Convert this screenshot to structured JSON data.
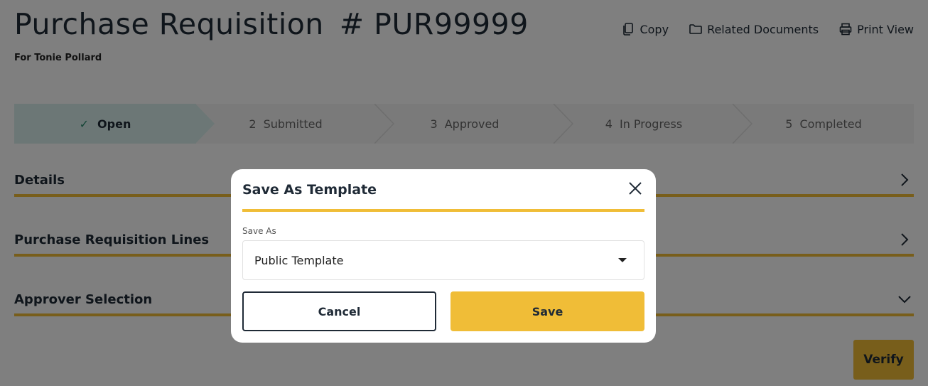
{
  "header": {
    "title": "Purchase Requisition",
    "number": "# PUR99999",
    "subtitle": "For Tonie Pollard"
  },
  "actions": [
    {
      "label": "Copy",
      "icon": "copy-icon"
    },
    {
      "label": "Related Documents",
      "icon": "folder-icon"
    },
    {
      "label": "Print View",
      "icon": "printer-icon"
    }
  ],
  "stepper": {
    "steps": [
      {
        "num": "",
        "label": "Open",
        "state": "complete"
      },
      {
        "num": "2",
        "label": "Submitted",
        "state": "pending"
      },
      {
        "num": "3",
        "label": "Approved",
        "state": "pending"
      },
      {
        "num": "4",
        "label": "In Progress",
        "state": "pending"
      },
      {
        "num": "5",
        "label": "Completed",
        "state": "pending"
      }
    ]
  },
  "sections": [
    {
      "label": "Details",
      "icon": "chevron-right-icon"
    },
    {
      "label": "Purchase Requisition Lines",
      "icon": "chevron-right-icon"
    },
    {
      "label": "Approver Selection",
      "icon": "chevron-down-icon"
    }
  ],
  "verify_label": "Verify",
  "modal": {
    "title": "Save As Template",
    "field_label": "Save As",
    "selected": "Public Template",
    "cancel_label": "Cancel",
    "save_label": "Save"
  },
  "colors": {
    "accent": "#f0bd37",
    "active_step": "#d8efec",
    "text_dark": "#1f2a36"
  }
}
